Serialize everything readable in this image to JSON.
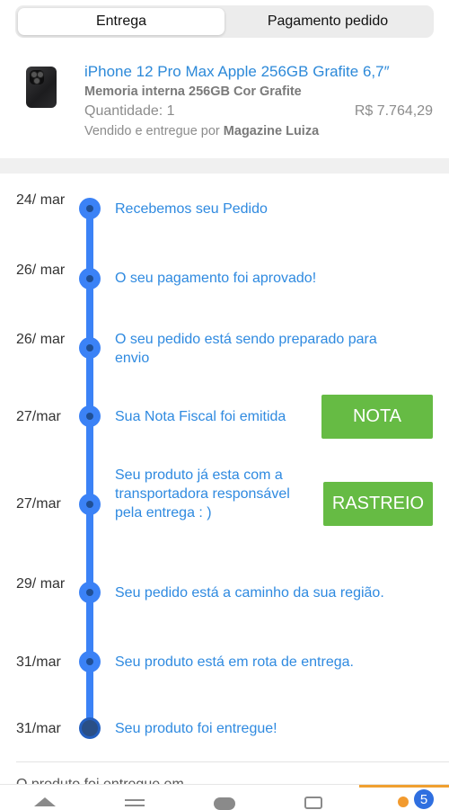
{
  "tabs": [
    {
      "label": "Entrega",
      "active": true
    },
    {
      "label": "Pagamento pedido",
      "active": false
    }
  ],
  "product": {
    "title": "iPhone 12 Pro Max Apple 256GB Grafite 6,7″",
    "subtitle": "Memoria interna 256GB Cor Grafite",
    "quantity": "Quantidade: 1",
    "price": "R$ 7.764,29",
    "seller_prefix": "Vendido e entregue por",
    "seller_name": "Magazine Luiza",
    "image_icon": "phone-image"
  },
  "timeline": [
    {
      "date": "24/ mar",
      "text": "Recebemos seu Pedido"
    },
    {
      "date": "26/ mar",
      "text": "O seu pagamento foi aprovado!"
    },
    {
      "date": "26/ mar",
      "text": "O seu pedido está sendo preparado para envio"
    },
    {
      "date": "27/mar",
      "text": "Sua Nota Fiscal foi emitida",
      "button": "NOTA"
    },
    {
      "date": "27/mar",
      "text": "Seu produto já esta com a transportadora responsável pela entrega : )",
      "button": "RASTREIO"
    },
    {
      "date": "29/ mar",
      "text": "Seu pedido está a caminho da sua região."
    },
    {
      "date": "31/mar",
      "text": "Seu produto está em rota de entrega."
    },
    {
      "date": "31/mar",
      "text": "Seu produto foi entregue!"
    }
  ],
  "footer_text": "O produto foi entregue em",
  "bottom_nav": {
    "items": [
      "home-icon",
      "list-icon",
      "chat-icon",
      "bag-icon",
      "account-icon"
    ],
    "badge": "5"
  },
  "colors": {
    "accent_blue": "#3b82f6",
    "link_blue": "#2f8ae0",
    "button_green": "#66bb44",
    "nav_active": "#f0a030"
  }
}
